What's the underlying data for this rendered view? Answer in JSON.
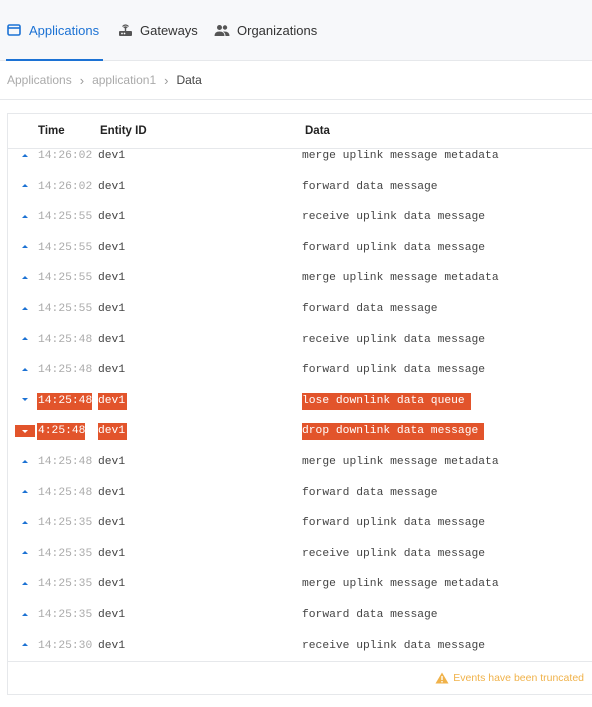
{
  "nav": {
    "items": [
      {
        "label": "Applications",
        "icon": "application-window-icon",
        "active": true
      },
      {
        "label": "Gateways",
        "icon": "router-icon",
        "active": false
      },
      {
        "label": "Organizations",
        "icon": "people-icon",
        "active": false
      }
    ]
  },
  "breadcrumb": {
    "items": [
      "Applications",
      "application1"
    ],
    "current": "Data"
  },
  "table": {
    "columns": {
      "time": "Time",
      "entity": "Entity ID",
      "data": "Data"
    },
    "rows": [
      {
        "time": "14:26:02",
        "entity": "dev1",
        "data": "merge uplink message metadata",
        "direction": "up",
        "error": false
      },
      {
        "time": "14:26:02",
        "entity": "dev1",
        "data": "forward data message",
        "direction": "up",
        "error": false
      },
      {
        "time": "14:25:55",
        "entity": "dev1",
        "data": "receive uplink data message",
        "direction": "up",
        "error": false
      },
      {
        "time": "14:25:55",
        "entity": "dev1",
        "data": "forward uplink data message",
        "direction": "up",
        "error": false
      },
      {
        "time": "14:25:55",
        "entity": "dev1",
        "data": "merge uplink message metadata",
        "direction": "up",
        "error": false
      },
      {
        "time": "14:25:55",
        "entity": "dev1",
        "data": "forward data message",
        "direction": "up",
        "error": false
      },
      {
        "time": "14:25:48",
        "entity": "dev1",
        "data": "receive uplink data message",
        "direction": "up",
        "error": false
      },
      {
        "time": "14:25:48",
        "entity": "dev1",
        "data": "forward uplink data message",
        "direction": "up",
        "error": false
      },
      {
        "time": "14:25:48",
        "entity": "dev1",
        "data": "lose downlink data queue",
        "direction": "down",
        "error": true
      },
      {
        "time": "4:25:48",
        "entity": "dev1",
        "data": "drop downlink data message",
        "direction": "down",
        "error": true
      },
      {
        "time": "14:25:48",
        "entity": "dev1",
        "data": "merge uplink message metadata",
        "direction": "up",
        "error": false
      },
      {
        "time": "14:25:48",
        "entity": "dev1",
        "data": "forward data message",
        "direction": "up",
        "error": false
      },
      {
        "time": "14:25:35",
        "entity": "dev1",
        "data": "forward uplink data message",
        "direction": "up",
        "error": false
      },
      {
        "time": "14:25:35",
        "entity": "dev1",
        "data": "receive uplink data message",
        "direction": "up",
        "error": false
      },
      {
        "time": "14:25:35",
        "entity": "dev1",
        "data": "merge uplink message metadata",
        "direction": "up",
        "error": false
      },
      {
        "time": "14:25:35",
        "entity": "dev1",
        "data": "forward data message",
        "direction": "up",
        "error": false
      },
      {
        "time": "14:25:30",
        "entity": "dev1",
        "data": "receive uplink data message",
        "direction": "up",
        "error": false
      }
    ]
  },
  "footer": {
    "warning_text": "Events have been truncated",
    "warning_icon": "warning-triangle-icon",
    "warning_color": "#f0b24a"
  },
  "colors": {
    "accent": "#1c72d4",
    "error": "#e2542b"
  }
}
